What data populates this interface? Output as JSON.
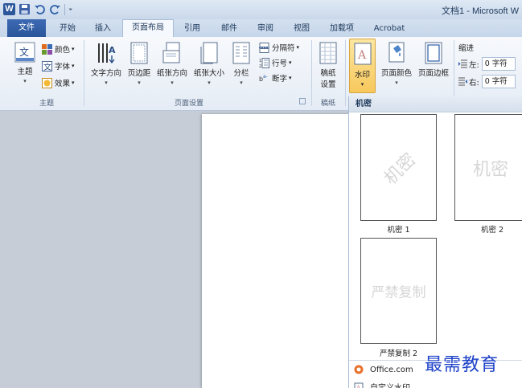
{
  "window": {
    "title": "文档1 - Microsoft W"
  },
  "tabs": [
    {
      "label": "文件"
    },
    {
      "label": "开始"
    },
    {
      "label": "插入"
    },
    {
      "label": "页面布局"
    },
    {
      "label": "引用"
    },
    {
      "label": "邮件"
    },
    {
      "label": "审阅"
    },
    {
      "label": "视图"
    },
    {
      "label": "加载项"
    },
    {
      "label": "Acrobat"
    }
  ],
  "ribbon": {
    "theme_group": {
      "label": "主题",
      "theme_button": "主题",
      "colors": "颜色",
      "fonts": "字体",
      "effects": "效果"
    },
    "page_setup_group": {
      "label": "页面设置",
      "text_direction": "文字方向",
      "margins": "页边距",
      "orientation": "纸张方向",
      "size": "纸张大小",
      "columns": "分栏",
      "breaks": "分隔符",
      "line_numbers": "行号",
      "hyphenation": "断字"
    },
    "draft_group": {
      "label": "稿纸",
      "draft_setup_line1": "稿纸",
      "draft_setup_line2": "设置"
    },
    "page_background": {
      "watermark": "水印",
      "page_color": "页面颜色",
      "page_borders": "页面边框"
    },
    "indent": {
      "title": "缩进",
      "left_label": "左:",
      "left_value": "0 字符",
      "right_label": "右:",
      "right_value": "0 字符"
    }
  },
  "watermark_gallery": {
    "header": "机密",
    "items": [
      {
        "label": "机密 1",
        "preview_text": "机密"
      },
      {
        "label": "机密 2",
        "preview_text": "机密"
      },
      {
        "label": "严禁复制 2",
        "preview_text": "严禁复制"
      }
    ],
    "footer_items": [
      {
        "label": "Office.com"
      },
      {
        "label": "自定义水印"
      }
    ]
  },
  "brand_overlay": "最需教育",
  "colors": {
    "file_tab": "#2a5599",
    "watermark_highlight": "#f7c85c",
    "brand_text": "#1f43c9"
  }
}
